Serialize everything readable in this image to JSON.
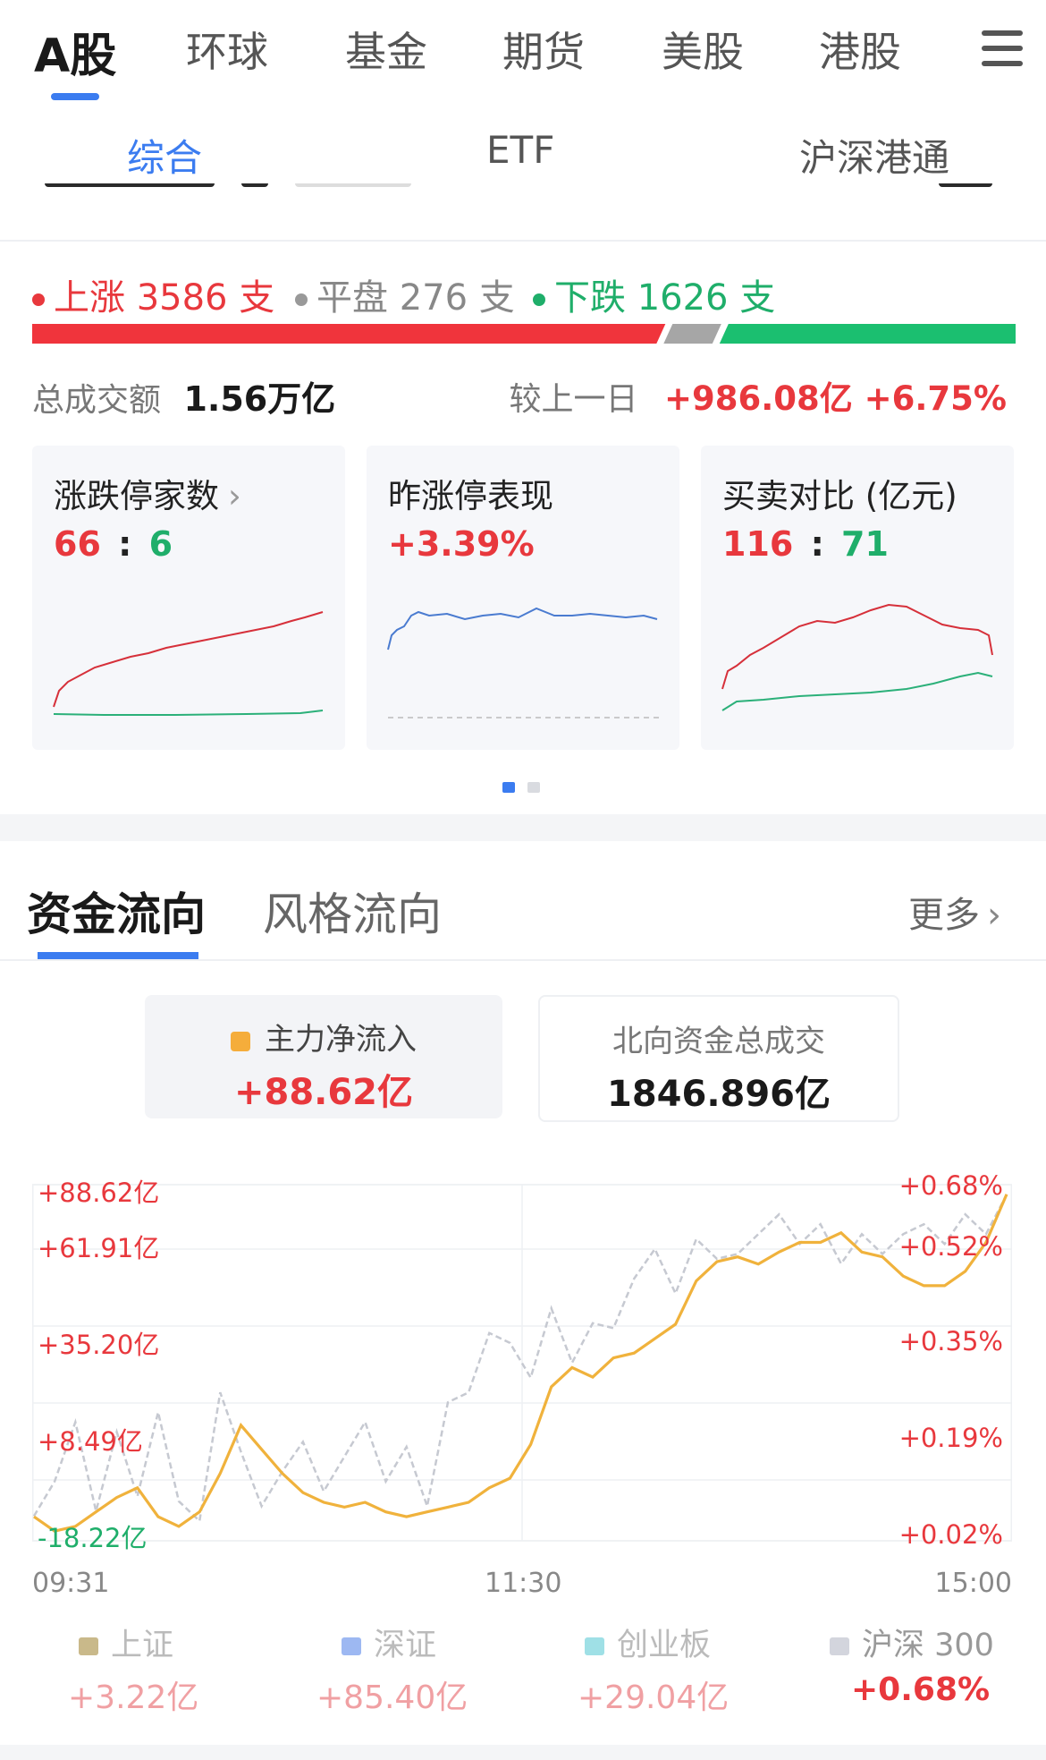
{
  "top_nav": {
    "tabs": [
      "A股",
      "环球",
      "基金",
      "期货",
      "美股",
      "港股"
    ],
    "active_index": 0
  },
  "sub_tabs": {
    "items": [
      "综合",
      "ETF",
      "沪深港通"
    ],
    "active_index": 0
  },
  "market": {
    "up_label": "上涨 3586 支",
    "flat_label": "平盘 276 支",
    "down_label": "下跌 1626 支",
    "up_count": 3586,
    "flat_count": 276,
    "down_count": 1626,
    "turnover_label": "总成交额",
    "turnover_value": "1.56万亿",
    "compare_label": "较上一日",
    "compare_value": "+986.08亿 +6.75%"
  },
  "cards": [
    {
      "title": "涨跌停家数",
      "value_up": "66",
      "sep": ":",
      "value_down": "6"
    },
    {
      "title": "昨涨停表现",
      "value": "+3.39%"
    },
    {
      "title": "买卖对比 (亿元)",
      "value_up": "116",
      "sep": ":",
      "value_down": "71"
    }
  ],
  "pager": {
    "pages": 2,
    "current": 0
  },
  "fund_flow": {
    "tabs": [
      "资金流向",
      "风格流向"
    ],
    "active_index": 0,
    "more_label": "更多",
    "main_inflow": {
      "label": "主力净流入",
      "value": "+88.62亿"
    },
    "northbound": {
      "label": "北向资金总成交",
      "value": "1846.896亿"
    },
    "legend": [
      {
        "name": "上证",
        "value": "+3.22亿",
        "color": "#c9b98a"
      },
      {
        "name": "深证",
        "value": "+85.40亿",
        "color": "#9db8f2"
      },
      {
        "name": "创业板",
        "value": "+29.04亿",
        "color": "#9fe0e6"
      },
      {
        "name": "沪深 300",
        "value": "+0.68%",
        "color": "#d3d5dd"
      }
    ]
  },
  "colors": {
    "up": "#e8383d",
    "down": "#1fae6a",
    "accent": "#3b7cf0",
    "flow": "#f0b23c",
    "hs300": "#c6c9d1"
  },
  "chart_data": {
    "type": "line",
    "x_ticks": [
      "09:31",
      "11:30",
      "15:00"
    ],
    "left_axis_ticks": [
      "+88.62亿",
      "+61.91亿",
      "+35.20亿",
      "+8.49亿",
      "-18.22亿"
    ],
    "right_axis_ticks": [
      "+0.68%",
      "+0.52%",
      "+0.35%",
      "+0.19%",
      "+0.02%"
    ],
    "series": [
      {
        "name": "主力净流入",
        "values": [
          -10,
          -16,
          -14,
          -8,
          -2,
          2,
          -10,
          -14,
          -8,
          8,
          28,
          18,
          8,
          0,
          -4,
          -6,
          -4,
          -8,
          -10,
          -8,
          -6,
          -4,
          2,
          6,
          20,
          44,
          52,
          48,
          56,
          58,
          64,
          70,
          88,
          96,
          98,
          95,
          100,
          104,
          104,
          108,
          100,
          98,
          90,
          86,
          86,
          92,
          104,
          124
        ]
      },
      {
        "name": "沪深 300",
        "unit": "%",
        "values": [
          0.05,
          0.12,
          0.24,
          0.06,
          0.22,
          0.09,
          0.26,
          0.08,
          0.04,
          0.3,
          0.18,
          0.07,
          0.14,
          0.2,
          0.1,
          0.17,
          0.24,
          0.12,
          0.19,
          0.07,
          0.28,
          0.3,
          0.42,
          0.4,
          0.33,
          0.47,
          0.36,
          0.44,
          0.43,
          0.53,
          0.59,
          0.5,
          0.61,
          0.57,
          0.58,
          0.62,
          0.66,
          0.6,
          0.64,
          0.56,
          0.62,
          0.58,
          0.62,
          0.64,
          0.6,
          0.66,
          0.62,
          0.7
        ]
      }
    ]
  }
}
